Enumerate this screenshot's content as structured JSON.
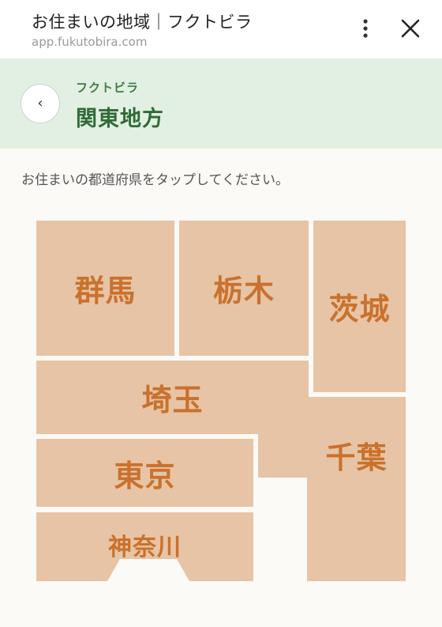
{
  "topbar": {
    "title": "お住まいの地域｜フクトビラ",
    "url": "app.fukutobira.com"
  },
  "header": {
    "subtitle": "フクトビラ",
    "title": "関東地方"
  },
  "instruction": "お住まいの都道府県をタップしてください。",
  "prefectures": {
    "gunma": "群馬",
    "tochigi": "栃木",
    "ibaraki": "茨城",
    "saitama": "埼玉",
    "tokyo": "東京",
    "chiba": "千葉",
    "kanagawa": "神奈川"
  },
  "colors": {
    "header_bg": "#e2efe3",
    "accent_green": "#2f6b37",
    "tile_fill": "#e7c4a5",
    "tile_text": "#c9712d"
  }
}
